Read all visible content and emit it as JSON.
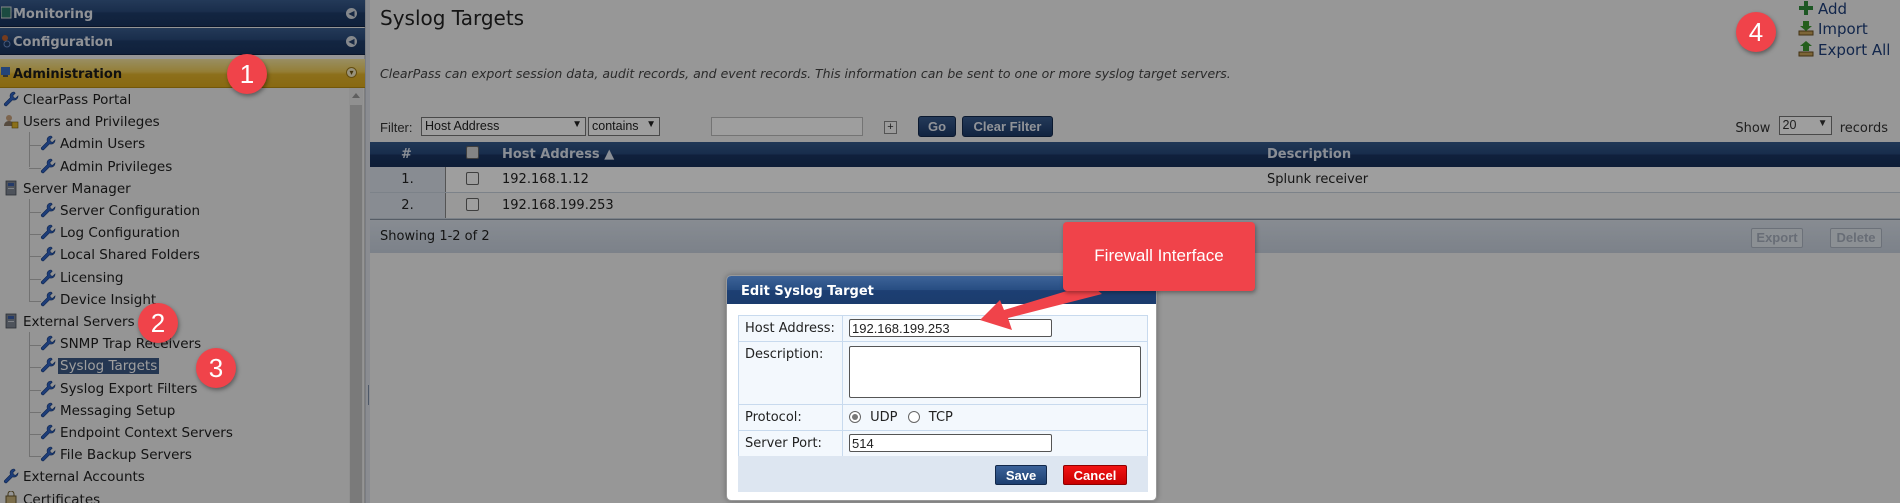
{
  "sidebar": {
    "sections": [
      {
        "label": "Monitoring",
        "icon": "monitor-icon",
        "expanded": false
      },
      {
        "label": "Configuration",
        "icon": "gears-icon",
        "expanded": false
      },
      {
        "label": "Administration",
        "icon": "admin-computer-icon",
        "expanded": true
      }
    ],
    "tree": [
      {
        "label": "ClearPass Portal",
        "level": 0,
        "icon": "wrench-icon"
      },
      {
        "label": "Users and Privileges",
        "level": 0,
        "icon": "users-lock-icon"
      },
      {
        "label": "Admin Users",
        "level": 1,
        "icon": "wrench-icon"
      },
      {
        "label": "Admin Privileges",
        "level": 1,
        "icon": "wrench-icon"
      },
      {
        "label": "Server Manager",
        "level": 0,
        "icon": "server-icon"
      },
      {
        "label": "Server Configuration",
        "level": 1,
        "icon": "wrench-icon"
      },
      {
        "label": "Log Configuration",
        "level": 1,
        "icon": "wrench-icon"
      },
      {
        "label": "Local Shared Folders",
        "level": 1,
        "icon": "wrench-icon"
      },
      {
        "label": "Licensing",
        "level": 1,
        "icon": "wrench-icon"
      },
      {
        "label": "Device Insight",
        "level": 1,
        "icon": "wrench-icon"
      },
      {
        "label": "External Servers",
        "level": 0,
        "icon": "server-icon"
      },
      {
        "label": "SNMP Trap Receivers",
        "level": 1,
        "icon": "wrench-icon"
      },
      {
        "label": "Syslog Targets",
        "level": 1,
        "icon": "wrench-icon",
        "selected": true
      },
      {
        "label": "Syslog Export Filters",
        "level": 1,
        "icon": "wrench-icon"
      },
      {
        "label": "Messaging Setup",
        "level": 1,
        "icon": "wrench-icon"
      },
      {
        "label": "Endpoint Context Servers",
        "level": 1,
        "icon": "wrench-icon"
      },
      {
        "label": "File Backup Servers",
        "level": 1,
        "icon": "wrench-icon"
      },
      {
        "label": "External Accounts",
        "level": 0,
        "icon": "wrench-icon"
      },
      {
        "label": "Certificates",
        "level": 0,
        "icon": "certificate-icon"
      }
    ]
  },
  "page": {
    "title": "Syslog Targets",
    "description": "ClearPass can export session data, audit records, and event records. This information can be sent to one or more syslog target servers.",
    "actions": [
      {
        "label": "Add",
        "icon": "add-plus-icon"
      },
      {
        "label": "Import",
        "icon": "import-icon"
      },
      {
        "label": "Export All",
        "icon": "export-icon"
      }
    ]
  },
  "filter": {
    "label": "Filter:",
    "field": "Host Address",
    "operator": "contains",
    "value": "",
    "go_label": "Go",
    "clear_label": "Clear Filter",
    "show_label": "Show",
    "show_value": "20",
    "records_label": "records"
  },
  "table": {
    "columns": [
      "#",
      "",
      "Host Address ▲",
      "Description"
    ],
    "rows": [
      {
        "num": "1.",
        "host": "192.168.1.12",
        "description": "Splunk receiver"
      },
      {
        "num": "2.",
        "host": "192.168.199.253",
        "description": ""
      }
    ],
    "showing": "Showing 1-2 of 2",
    "export_label": "Export",
    "delete_label": "Delete"
  },
  "dialog": {
    "title": "Edit Syslog Target",
    "host_label": "Host Address:",
    "host_value": "192.168.199.253",
    "desc_label": "Description:",
    "desc_value": "",
    "protocol_label": "Protocol:",
    "protocol_options": [
      "UDP",
      "TCP"
    ],
    "protocol_selected": "UDP",
    "port_label": "Server Port:",
    "port_value": "514",
    "save_label": "Save",
    "cancel_label": "Cancel"
  },
  "annotations": {
    "badges": [
      "1",
      "2",
      "3",
      "4"
    ],
    "callout": "Firewall Interface",
    "color": "#f0434a"
  }
}
